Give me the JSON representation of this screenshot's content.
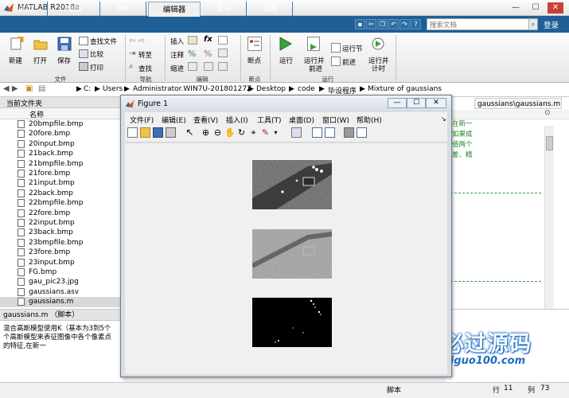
{
  "app": {
    "title": "MATLAB R2018a",
    "window_controls": [
      "—",
      "☐",
      "✕"
    ]
  },
  "tabs": [
    {
      "label": "主页",
      "active": false
    },
    {
      "label": "绘图",
      "active": false
    },
    {
      "label": "APP",
      "active": false
    },
    {
      "label": "编辑器",
      "active": true
    },
    {
      "label": "发布",
      "active": false
    },
    {
      "label": "视图",
      "active": false
    }
  ],
  "search": {
    "placeholder": "搜索文档"
  },
  "login_label": "登录",
  "ribbon": {
    "file_group": {
      "label": "文件",
      "new": "新建",
      "open": "打开",
      "save": "保存",
      "find_files": "查找文件",
      "compare": "比较",
      "print": "打印"
    },
    "nav_group": {
      "label": "导航",
      "goto": "转至",
      "find": "查找"
    },
    "edit_group": {
      "label": "编辑",
      "insert": "插入",
      "comment": "注释",
      "indent": "缩进",
      "fx": "fx"
    },
    "breakpoint_group": {
      "label": "断点",
      "breakpoints": "断点"
    },
    "run_group": {
      "label": "运行",
      "run": "运行",
      "run_advance_1": "运行并",
      "run_advance_2": "前进",
      "run_section": "运行节",
      "advance": "前进",
      "run_time_1": "运行并",
      "run_time_2": "计时"
    }
  },
  "address": {
    "segments": [
      "C:",
      "Users",
      "Administrator.WIN7U-20180127Z",
      "Desktop",
      "code",
      "毕设程序",
      "Mixture of gaussians"
    ]
  },
  "file_browser": {
    "title": "当前文件夹",
    "column": "名称",
    "files": [
      {
        "name": "20bmpfile.bmp",
        "selected": false
      },
      {
        "name": "20fore.bmp",
        "selected": false
      },
      {
        "name": "20input.bmp",
        "selected": false
      },
      {
        "name": "21back.bmp",
        "selected": false
      },
      {
        "name": "21bmpfile.bmp",
        "selected": false
      },
      {
        "name": "21fore.bmp",
        "selected": false
      },
      {
        "name": "21input.bmp",
        "selected": false
      },
      {
        "name": "22back.bmp",
        "selected": false
      },
      {
        "name": "22bmpfile.bmp",
        "selected": false
      },
      {
        "name": "22fore.bmp",
        "selected": false
      },
      {
        "name": "22input.bmp",
        "selected": false
      },
      {
        "name": "23back.bmp",
        "selected": false
      },
      {
        "name": "23bmpfile.bmp",
        "selected": false
      },
      {
        "name": "23fore.bmp",
        "selected": false
      },
      {
        "name": "23input.bmp",
        "selected": false
      },
      {
        "name": "FG.bmp",
        "selected": false
      },
      {
        "name": "gau_pic23.jpg",
        "selected": false
      },
      {
        "name": "gaussians.asv",
        "selected": false
      },
      {
        "name": "gaussians.m",
        "selected": true
      }
    ]
  },
  "details": {
    "header": "gaussians.m （脚本）",
    "lines": [
      "混合高斯模型使用K（基本为3到5个",
      "个高斯模型来表征图像中各个像素点",
      "的特征,在新一"
    ]
  },
  "editor": {
    "tab_label": "gaussians\\gaussians.m",
    "comment_lines": [
      "在新一",
      "如果成",
      "值两个",
      "差、精"
    ]
  },
  "status": {
    "type": "脚本",
    "row_label": "行",
    "row": "11",
    "col_label": "列",
    "col": "73"
  },
  "figure": {
    "title": "Figure 1",
    "menus": [
      "文件(F)",
      "编辑(E)",
      "查看(V)",
      "插入(I)",
      "工具(T)",
      "桌面(D)",
      "窗口(W)",
      "帮助(H)"
    ]
  },
  "watermark": {
    "text": "必过源码",
    "url": "Biguo100.com"
  }
}
